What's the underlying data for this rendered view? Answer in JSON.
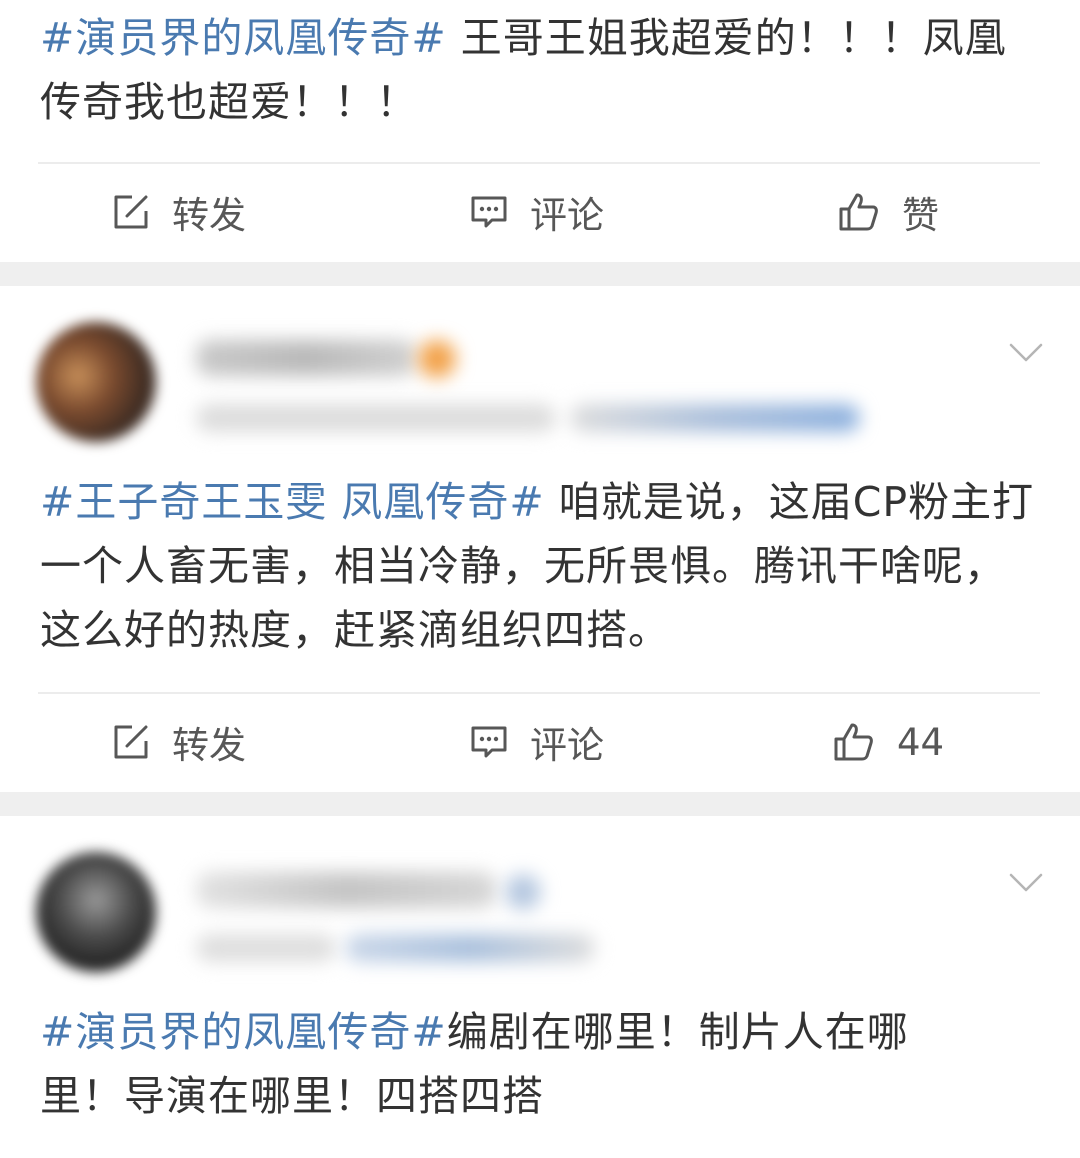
{
  "posts": [
    {
      "segments": [
        {
          "text": "#演员界的凤凰传奇#",
          "tag": true
        },
        {
          "text": " 王哥王姐我超爱的！！！凤凰传奇我也超爱！！！",
          "tag": false
        }
      ],
      "actions": {
        "repost": "转发",
        "comment": "评论",
        "like": "赞"
      }
    },
    {
      "segments": [
        {
          "text": "#王子奇王玉雯 凤凰传奇#",
          "tag": true
        },
        {
          "text": " 咱就是说，这届CP粉主打一个人畜无害，相当冷静，无所畏惧。腾讯干啥呢，这么好的热度，赶紧滴组织四搭。",
          "tag": false
        }
      ],
      "actions": {
        "repost": "转发",
        "comment": "评论",
        "like": "44"
      }
    },
    {
      "segments": [
        {
          "text": "#演员界的凤凰传奇#",
          "tag": true
        },
        {
          "text": "编剧在哪里！制片人在哪里！导演在哪里！四搭四搭",
          "tag": false
        }
      ]
    }
  ],
  "colors": {
    "hashtag": "#4a7ab0",
    "text": "#333333",
    "separator": "#efefef"
  },
  "icons": {
    "repost": "edit-share-icon",
    "comment": "comment-bubble-icon",
    "like": "thumbs-up-icon",
    "menu": "chevron-down-icon"
  }
}
